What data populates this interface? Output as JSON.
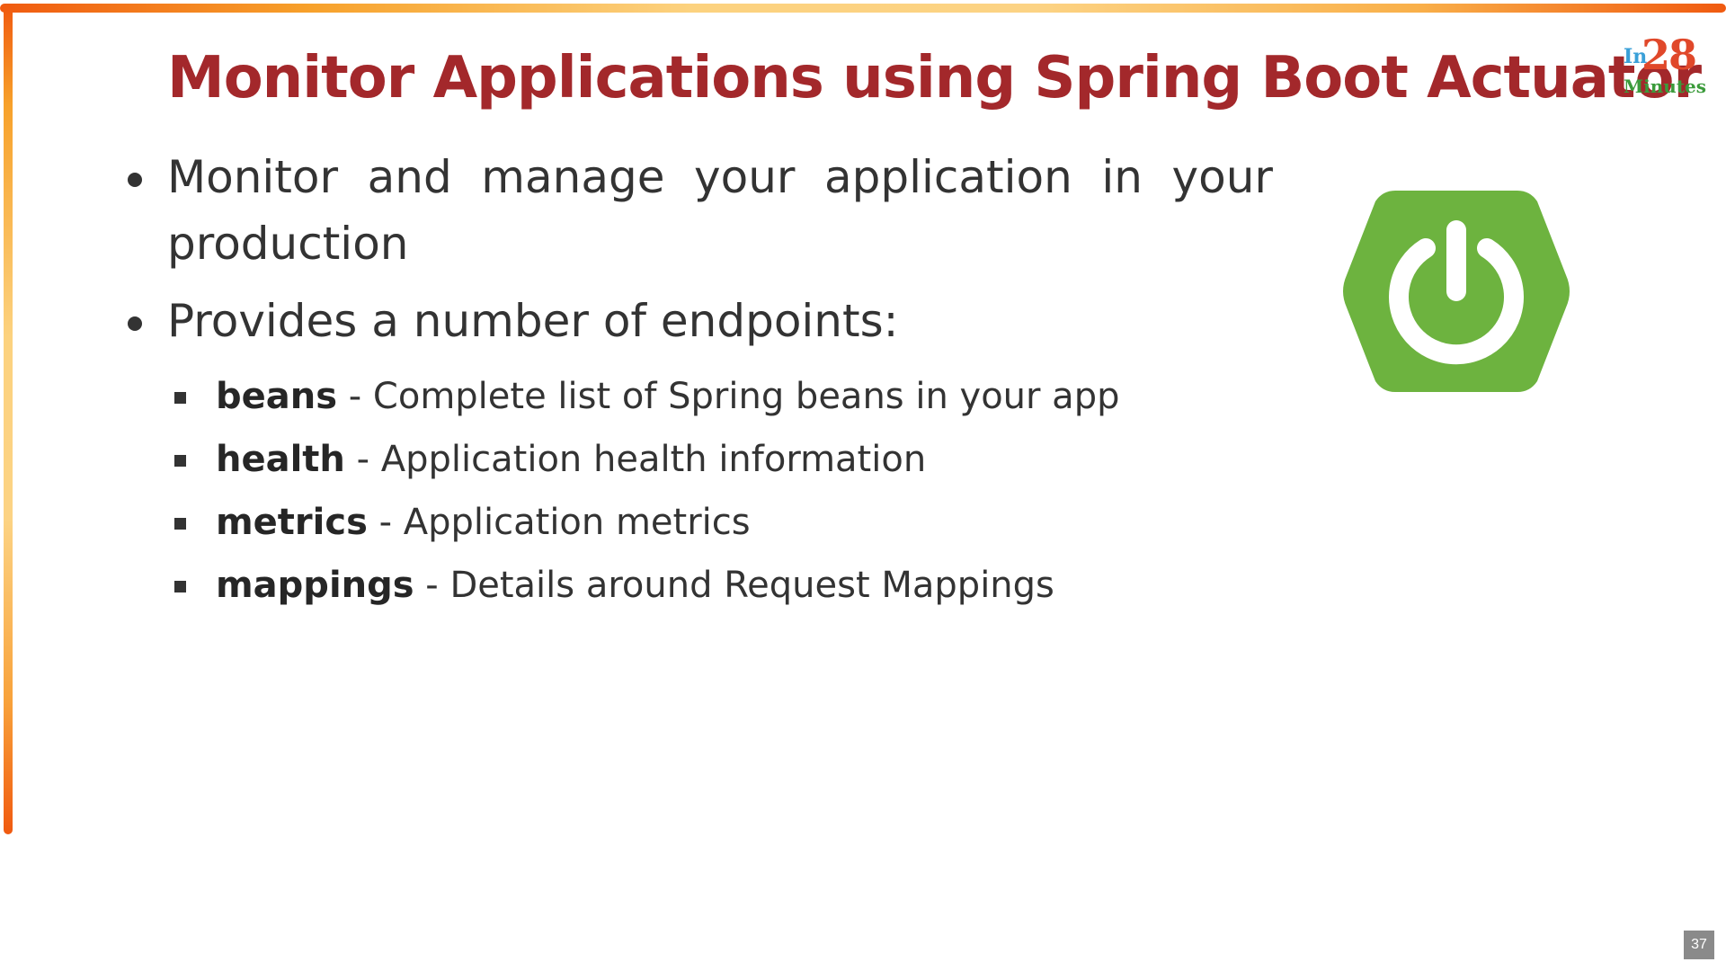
{
  "slide": {
    "title": "Monitor Applications using Spring Boot Actuator",
    "logo": {
      "prefix": "In",
      "number": "28",
      "suffix": "Minutes"
    },
    "bullets": [
      {
        "line1": "Monitor and manage your application in your",
        "line2": "production"
      },
      {
        "text": "Provides a number of endpoints:"
      }
    ],
    "endpoints": [
      {
        "name": "beans",
        "description": " - Complete list of Spring beans in your app"
      },
      {
        "name": "health",
        "description": " - Application health information"
      },
      {
        "name": "metrics",
        "description": " - Application metrics"
      },
      {
        "name": "mappings",
        "description": " - Details around Request Mappings"
      }
    ],
    "page_number": "37",
    "colors": {
      "title": "#a3282b",
      "spring_green": "#6db33f",
      "border_orange": "#f05a10",
      "border_light": "#fcd27f"
    },
    "icons": {
      "spring_logo": "spring-power-hexagon-icon"
    }
  }
}
